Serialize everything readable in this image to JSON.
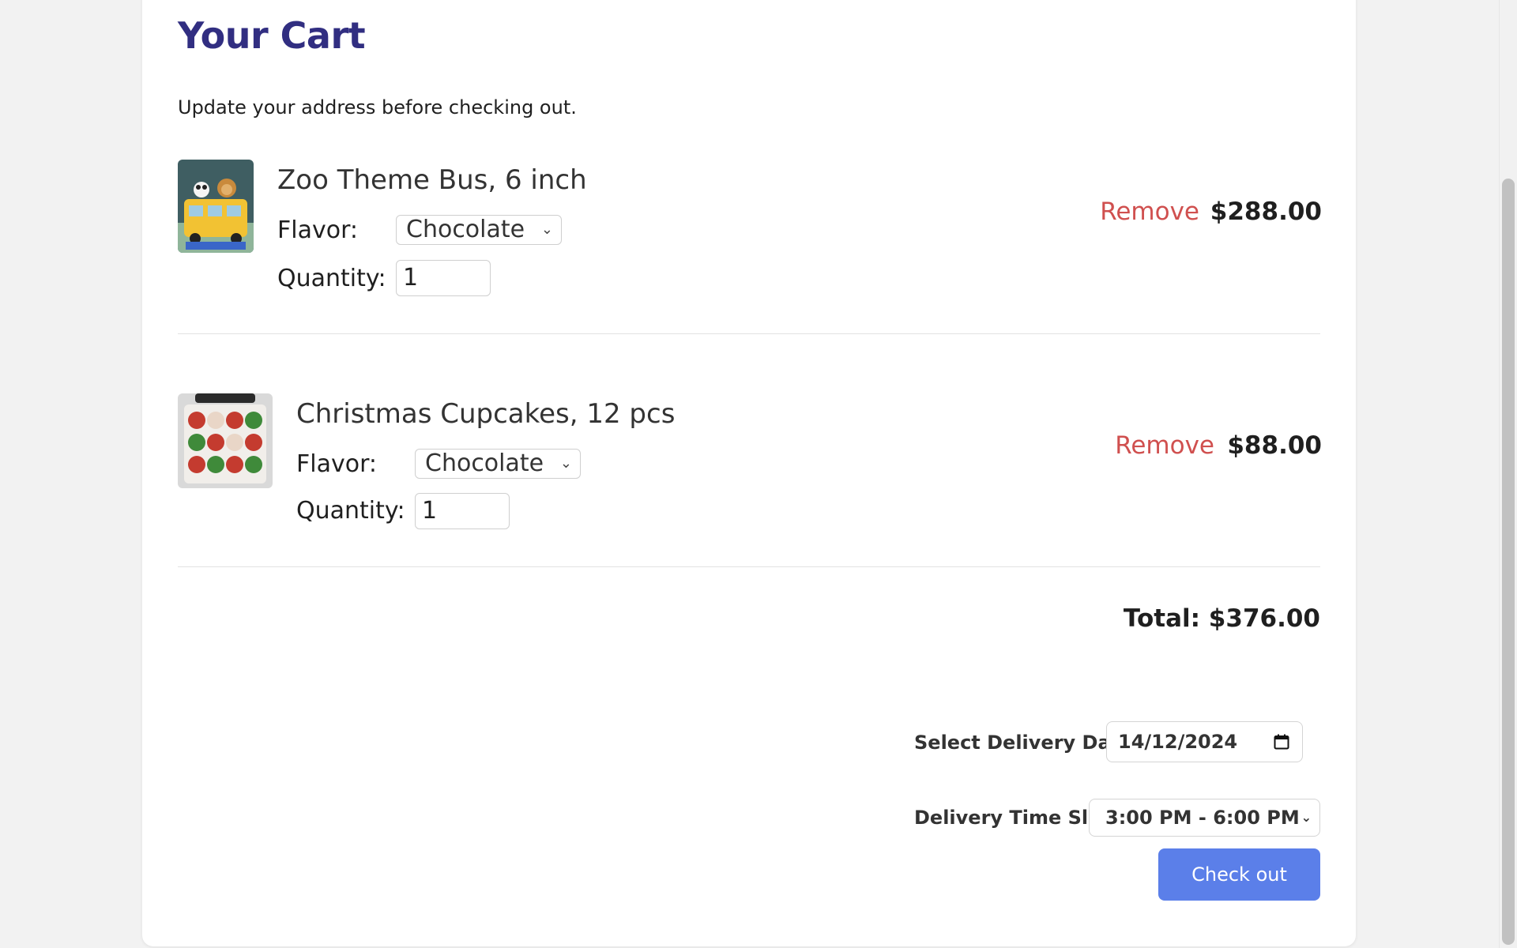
{
  "cart": {
    "title": "Your Cart",
    "notice": "Update your address before checking out."
  },
  "items": [
    {
      "name": "Zoo Theme Bus, 6 inch",
      "flavor_label": "Flavor:",
      "flavor_value": "Chocolate",
      "quantity_label": "Quantity:",
      "quantity_value": "1",
      "remove_label": "Remove",
      "price": "$288.00",
      "image_icon": "cake-photo"
    },
    {
      "name": "Christmas Cupcakes, 12 pcs",
      "flavor_label": "Flavor:",
      "flavor_value": "Chocolate",
      "quantity_label": "Quantity:",
      "quantity_value": "1",
      "remove_label": "Remove",
      "price": "$88.00",
      "image_icon": "cupcakes-photo"
    }
  ],
  "summary": {
    "total": "Total: $376.00"
  },
  "delivery": {
    "date_label": "Select Delivery Date:",
    "date_value": "14/12/2024",
    "time_label": "Delivery Time Slot:",
    "time_value": "3:00 PM - 6:00 PM"
  },
  "actions": {
    "checkout_label": "Check out"
  },
  "colors": {
    "title": "#312e81",
    "remove": "#d0504f",
    "checkout_bg": "#5b7fe9"
  }
}
